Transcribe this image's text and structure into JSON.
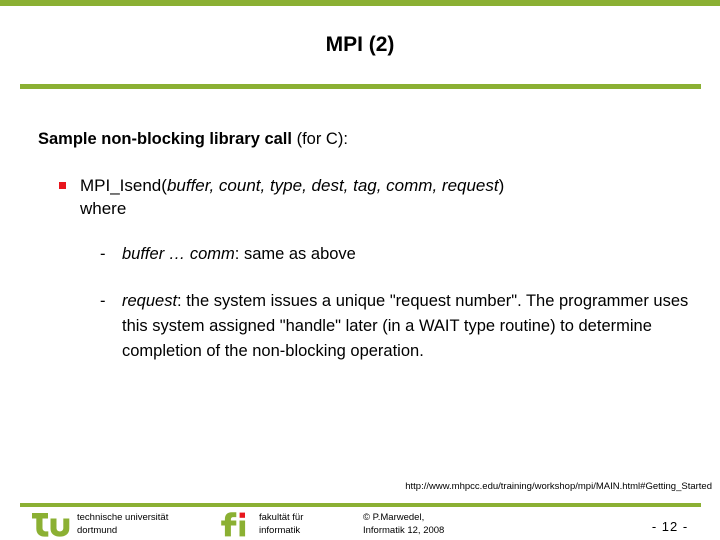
{
  "theme": {
    "accent_green": "#8bb033",
    "bullet_red": "#e8161d",
    "text_color": "#000000",
    "background": "#ffffff"
  },
  "slide": {
    "title": "MPI (2)",
    "lead": {
      "strong": "Sample non-blocking library call",
      "rest": " (for C):"
    },
    "bullet": {
      "call_name": "MPI_Isend(",
      "params": "buffer, count, type, dest, tag, comm, request",
      "close_paren": ")",
      "where": "where"
    },
    "sub_bullets": [
      {
        "dash": "-",
        "italic": "buffer … comm",
        "rest": ": same as above"
      },
      {
        "dash": "-",
        "italic": "request",
        "rest": ": the system issues a unique \"request number\". The programmer uses this system assigned \"handle\" later (in a WAIT type routine) to determine completion of the non-blocking operation."
      }
    ],
    "source_url": "http://www.mhpcc.edu/training/workshop/mpi/MAIN.html#Getting_Started"
  },
  "footer": {
    "tu_logo_text": "tu",
    "tu_label_line1": "technische universität",
    "tu_label_line2": "dortmund",
    "fi_logo_text": "fi",
    "fi_label_line1": "fakultät für",
    "fi_label_line2": "informatik",
    "copyright_line1": "© P.Marwedel,",
    "copyright_line2": "Informatik 12,  2008",
    "page_number": "-  12 -"
  }
}
